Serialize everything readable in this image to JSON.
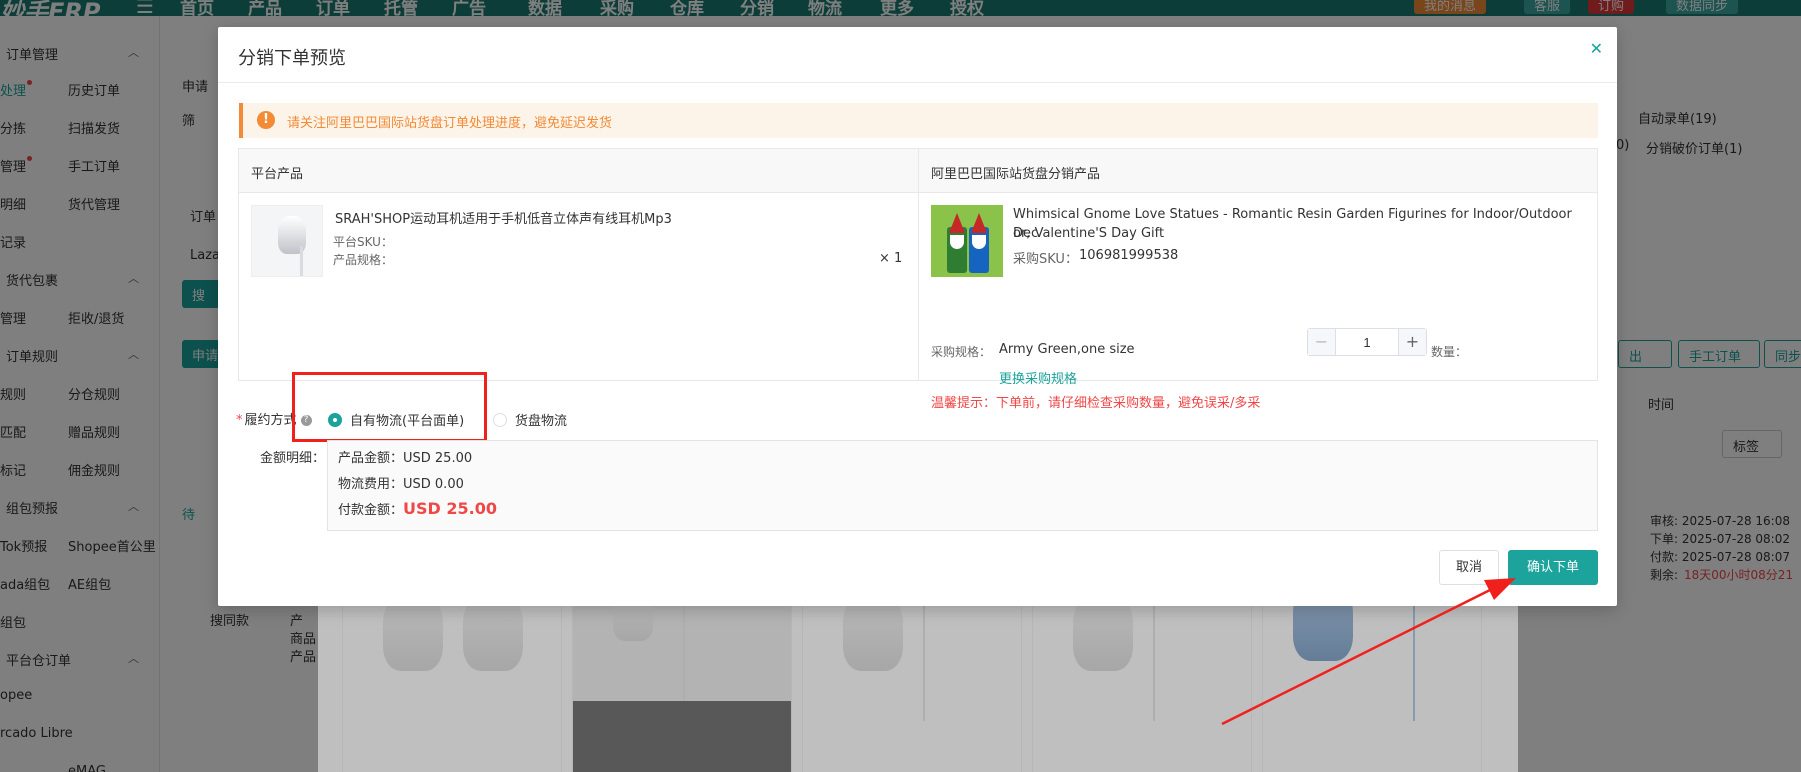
{
  "app": {
    "logo": "妙手ERP",
    "nav": [
      "首页",
      "产品",
      "订单",
      "托管",
      "广告",
      "数据",
      "采购",
      "仓库",
      "分销",
      "物流",
      "更多",
      "授权"
    ],
    "top_right": [
      "我的消息",
      "客服",
      "订购",
      "数据同步"
    ]
  },
  "sidebar": {
    "groups": [
      {
        "label": "订单管理"
      },
      {
        "label": "货代包裹"
      },
      {
        "label": "订单规则"
      },
      {
        "label": "组包预报"
      },
      {
        "label": "平台仓订单"
      }
    ],
    "items": {
      "r1a": "处理",
      "r1b": "历史订单",
      "r2a": "分拣",
      "r2b": "扫描发货",
      "r3a": "管理",
      "r3b": "手工订单",
      "r4a": "明细",
      "r4b": "货代管理",
      "r5a": "记录",
      "r6a": "管理",
      "r6b": "拒收/退货",
      "r7a": "规则",
      "r7b": "分仓规则",
      "r8a": "匹配",
      "r8b": "赠品规则",
      "r9a": "标记",
      "r9b": "佣金规则",
      "r10a": "Tok预报",
      "r10b": "Shopee首公里",
      "r11a": "ada组包",
      "r11b": "AE组包",
      "r12a": "组包",
      "r13a": "opee",
      "r14a": "rcado Libre",
      "r15a": "eMAG"
    }
  },
  "background": {
    "t1": "申请",
    "t2": "筛",
    "t3": "订单",
    "t4": "Laza",
    "auto_entry": "自动录单(19)",
    "t_paren": "0)",
    "low_price": "分销破价订单(1)",
    "time_header": "时间",
    "tag_btn": "标签",
    "manual_order_btn": "手工订单",
    "sync_btn": "同步订",
    "export_btn": "出",
    "audit": "审核: 2025-07-28 16:08",
    "ordered": "下单: 2025-07-28 08:02",
    "paid": "付款: 2025-07-28 08:07",
    "remaining_label": "剩余:",
    "remaining_value": "18天00小时08分21",
    "bg_apply": "申请",
    "bg_pending": "待",
    "bg_search": "搜",
    "bg_product": "产",
    "bg_product2": "商品",
    "bg_product3": "产品",
    "bg_search_more": "搜同款"
  },
  "modal": {
    "title": "分销下单预览",
    "alert": "请关注阿里巴巴国际站货盘订单处理进度，避免延迟发货",
    "platform_header": "平台产品",
    "distribution_header": "阿里巴巴国际站货盘分销产品",
    "platform_product": {
      "name": "SRAH'SHOP运动耳机适用于手机低音立体声有线耳机Mp3",
      "sku_label": "平台SKU：",
      "spec_label": "产品规格：",
      "qty": "× 1"
    },
    "distribution_product": {
      "name_line1": "Whimsical Gnome Love Statues - Romantic Resin Garden Figurines for Indoor/Outdoor Dec",
      "name_line2": "or, Valentine'S Day Gift",
      "sku_label": "采购SKU：",
      "sku_value": "106981999538",
      "spec_label": "采购规格：",
      "spec_value": "Army Green,one size",
      "qty_label": "数量：",
      "qty_value": "1",
      "change_spec_link": "更换采购规格",
      "warning": "温馨提示：下单前，请仔细检查采购数量，避免误采/多采"
    },
    "fulfillment": {
      "label": "履约方式",
      "options": [
        "自有物流(平台面单)",
        "货盘物流"
      ],
      "selected": "自有物流(平台面单)"
    },
    "amount": {
      "label": "金额明细：",
      "product_amount": "产品金额：USD 25.00",
      "shipping_fee": "物流费用：USD 0.00",
      "payment_label": "付款金额：",
      "payment_value": "USD 25.00"
    },
    "cancel": "取消",
    "confirm": "确认下单"
  },
  "colors": {
    "accent": "#1ba39c",
    "warning": "#f28a36",
    "danger": "#f04747",
    "annotation": "#f0201d"
  }
}
